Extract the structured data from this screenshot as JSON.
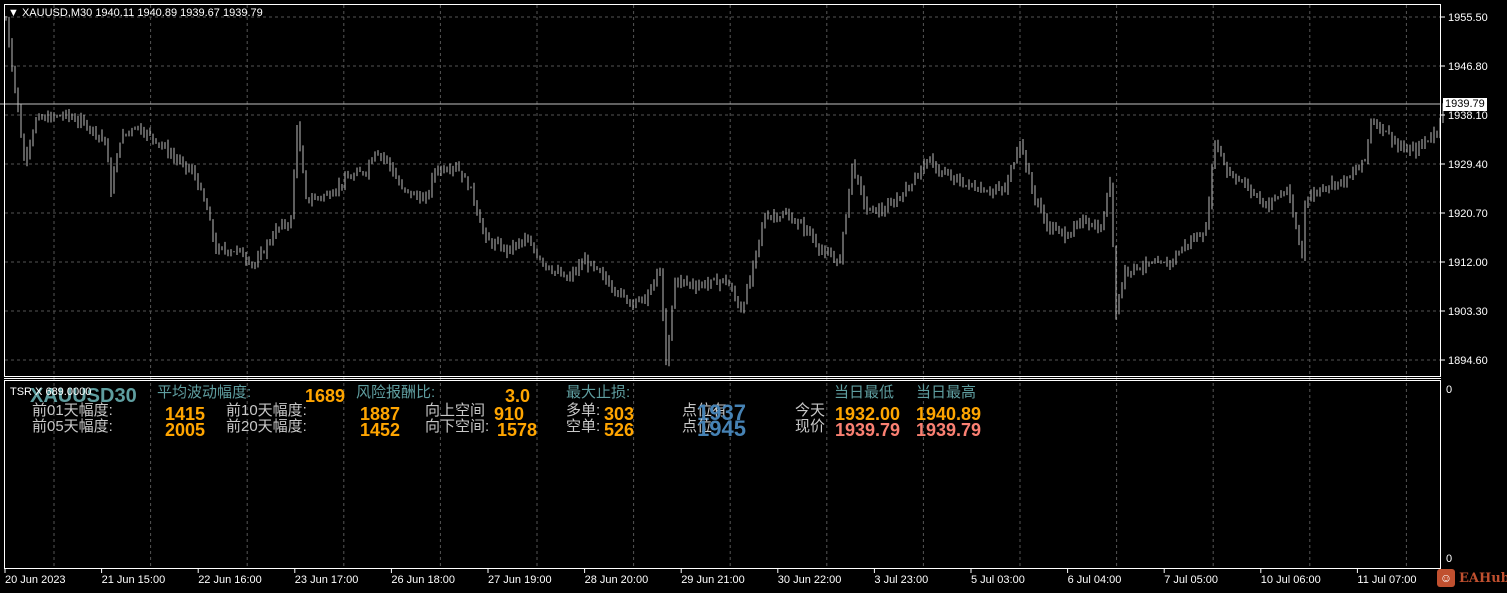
{
  "header": {
    "symbol": "XAUUSD,M30",
    "open": "1940.11",
    "high": "1940.89",
    "low": "1939.67",
    "close": "1939.79"
  },
  "price_axis": {
    "ticks": [
      "1955.50",
      "1946.80",
      "1938.10",
      "1929.40",
      "1920.70",
      "1912.00",
      "1903.30",
      "1894.60"
    ],
    "current": "1939.79"
  },
  "time_axis": [
    "20 Jun 2023",
    "21 Jun 15:00",
    "22 Jun 16:00",
    "23 Jun 17:00",
    "26 Jun 18:00",
    "27 Jun 19:00",
    "28 Jun 20:00",
    "29 Jun 21:00",
    "30 Jun 22:00",
    "3 Jul 23:00",
    "5 Jul 03:00",
    "6 Jul 04:00",
    "7 Jul 05:00",
    "10 Jul 06:00",
    "11 Jul 07:00"
  ],
  "chart_data": {
    "type": "candlestick",
    "ylim": [
      1894.6,
      1955.5
    ],
    "waypoints": [
      [
        0,
        1955.0
      ],
      [
        4,
        1939.0
      ],
      [
        6,
        1930.1
      ],
      [
        10,
        1937.2
      ],
      [
        20,
        1938.1
      ],
      [
        27,
        1936.3
      ],
      [
        33,
        1933.7
      ],
      [
        35,
        1924.8
      ],
      [
        38,
        1933.7
      ],
      [
        43,
        1936.3
      ],
      [
        50,
        1933.7
      ],
      [
        57,
        1930.1
      ],
      [
        63,
        1927.4
      ],
      [
        67,
        1921.2
      ],
      [
        70,
        1914.1
      ],
      [
        77,
        1914.1
      ],
      [
        83,
        1911.5
      ],
      [
        90,
        1917.7
      ],
      [
        95,
        1919.4
      ],
      [
        97,
        1936.3
      ],
      [
        100,
        1923.0
      ],
      [
        107,
        1923.9
      ],
      [
        113,
        1926.5
      ],
      [
        120,
        1928.3
      ],
      [
        123,
        1931.9
      ],
      [
        127,
        1930.1
      ],
      [
        132,
        1924.8
      ],
      [
        140,
        1923.0
      ],
      [
        143,
        1928.3
      ],
      [
        150,
        1929.2
      ],
      [
        155,
        1924.8
      ],
      [
        160,
        1915.9
      ],
      [
        167,
        1914.1
      ],
      [
        173,
        1915.9
      ],
      [
        180,
        1911.5
      ],
      [
        187,
        1908.8
      ],
      [
        193,
        1912.3
      ],
      [
        200,
        1908.8
      ],
      [
        207,
        1905.2
      ],
      [
        213,
        1905.2
      ],
      [
        218,
        1910.6
      ],
      [
        220,
        1893.7
      ],
      [
        223,
        1908.8
      ],
      [
        230,
        1907.9
      ],
      [
        240,
        1908.8
      ],
      [
        245,
        1903.5
      ],
      [
        248,
        1908.8
      ],
      [
        253,
        1920.3
      ],
      [
        260,
        1920.3
      ],
      [
        267,
        1917.7
      ],
      [
        273,
        1913.2
      ],
      [
        278,
        1912.3
      ],
      [
        282,
        1929.2
      ],
      [
        287,
        1921.2
      ],
      [
        293,
        1921.2
      ],
      [
        300,
        1924.8
      ],
      [
        307,
        1930.1
      ],
      [
        313,
        1927.4
      ],
      [
        320,
        1925.7
      ],
      [
        327,
        1924.8
      ],
      [
        333,
        1924.8
      ],
      [
        338,
        1933.7
      ],
      [
        342,
        1924.8
      ],
      [
        347,
        1918.5
      ],
      [
        353,
        1916.8
      ],
      [
        360,
        1919.4
      ],
      [
        365,
        1917.7
      ],
      [
        368,
        1926.5
      ],
      [
        370,
        1903.5
      ],
      [
        373,
        1910.6
      ],
      [
        380,
        1911.5
      ],
      [
        387,
        1911.5
      ],
      [
        393,
        1915.0
      ],
      [
        400,
        1917.7
      ],
      [
        403,
        1933.7
      ],
      [
        407,
        1928.3
      ],
      [
        413,
        1925.7
      ],
      [
        420,
        1922.1
      ],
      [
        427,
        1924.8
      ],
      [
        432,
        1913.2
      ],
      [
        433,
        1923.0
      ],
      [
        440,
        1925.7
      ],
      [
        447,
        1926.5
      ],
      [
        453,
        1930.1
      ],
      [
        455,
        1937.2
      ],
      [
        460,
        1935.4
      ],
      [
        465,
        1931.9
      ],
      [
        470,
        1931.9
      ],
      [
        477,
        1935.4
      ],
      [
        479,
        1939.79
      ]
    ]
  },
  "indicator": {
    "short_name": "TSR X 689.0000",
    "symbol_label": "XAUUSD30",
    "avg_range_label": "平均波动幅度:",
    "avg_range": "1689",
    "rr_label": "风险报酬比:",
    "rr": "3.0",
    "max_sl_label": "最大止损:",
    "day_low_label": "当日最低",
    "day_high_label": "当日最高",
    "d1_label": "前01天幅度:",
    "d1": "1415",
    "d10_label": "前10天幅度:",
    "d10": "1887",
    "up_label": "向上空间",
    "up": "910",
    "long_label": "多单:",
    "long": "303",
    "pt1_label": "点位有",
    "pt1": "1937",
    "today_label": "今天",
    "today_low": "1932.00",
    "today_high": "1940.89",
    "d5_label": "前05天幅度:",
    "d5": "2005",
    "d20_label": "前20天幅度:",
    "d20": "1452",
    "down_label": "向下空间:",
    "down": "1578",
    "short_label": "空单:",
    "short": "526",
    "pt2_label": "点位",
    "pt2": "1945",
    "price_label": "现价",
    "price_a": "1939.79",
    "price_b": "1939.79",
    "axis_top": "0",
    "axis_bottom": "0"
  },
  "watermark": "EAHub"
}
